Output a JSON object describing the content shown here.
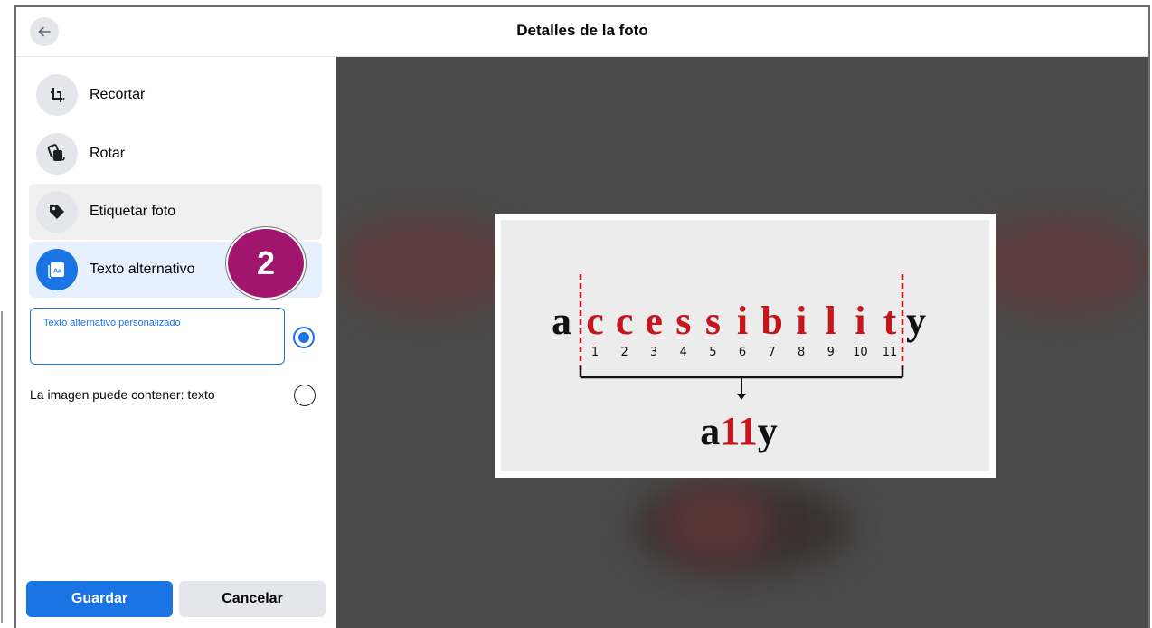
{
  "header": {
    "title": "Detalles de la foto",
    "back_icon": "arrow-left-icon"
  },
  "menu": {
    "items": [
      {
        "label": "Recortar",
        "icon": "crop-icon"
      },
      {
        "label": "Rotar",
        "icon": "rotate-icon"
      },
      {
        "label": "Etiquetar foto",
        "icon": "tag-icon"
      },
      {
        "label": "Texto alternativo",
        "icon": "alt-text-icon"
      }
    ]
  },
  "badge": {
    "number": "2",
    "color": "#a2156e"
  },
  "alt_text": {
    "custom_label": "Texto alternativo personalizado",
    "custom_value": "",
    "custom_selected": true,
    "auto_label": "La imagen puede contener: texto",
    "auto_selected": false
  },
  "buttons": {
    "save": "Guardar",
    "cancel": "Cancelar"
  },
  "photo": {
    "first_letter": "a",
    "middle_letters": [
      "c",
      "c",
      "e",
      "s",
      "s",
      "i",
      "b",
      "i",
      "l",
      "i",
      "t"
    ],
    "last_letter": "y",
    "numbers": [
      "1",
      "2",
      "3",
      "4",
      "5",
      "6",
      "7",
      "8",
      "9",
      "10",
      "11"
    ],
    "result_prefix": "a",
    "result_number": "11",
    "result_suffix": "y"
  },
  "colors": {
    "accent": "#1b74e4",
    "preview_bg": "#4a4a4a",
    "photo_red": "#c4161c"
  }
}
